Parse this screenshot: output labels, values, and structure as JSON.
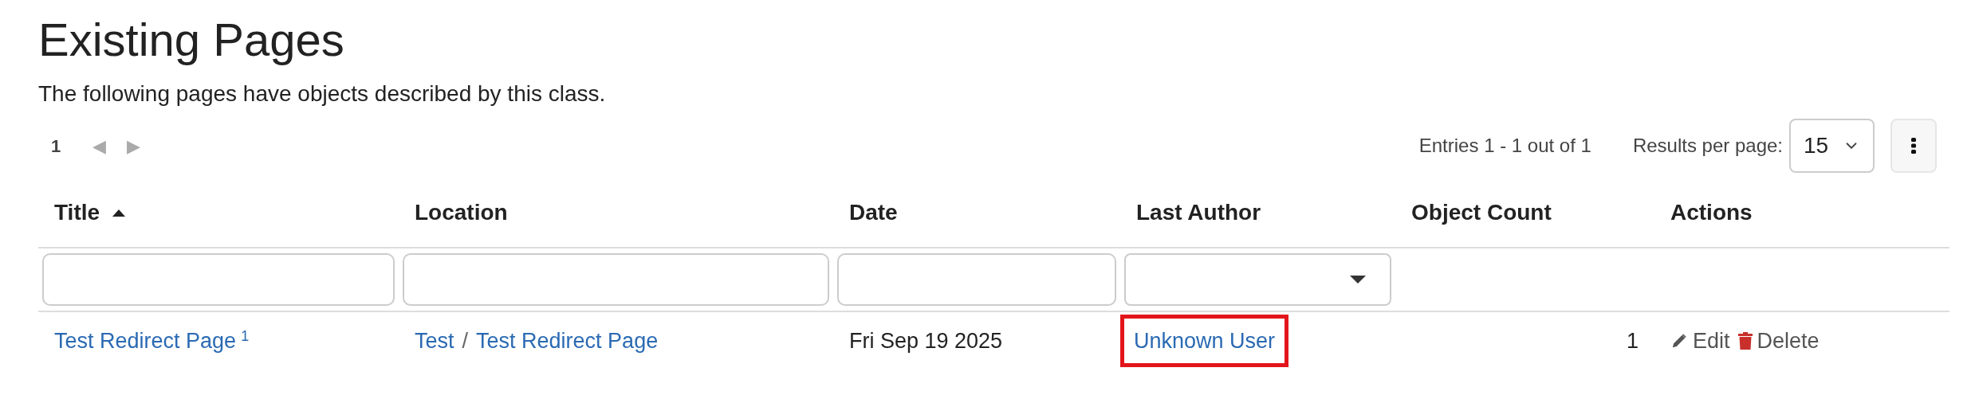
{
  "heading": "Existing Pages",
  "description": "The following pages have objects described by this class.",
  "pagination": {
    "current_page": "1",
    "previous": "◀",
    "next": "▶",
    "entries": "Entries 1 - 1 out of 1",
    "results_label": "Results per page:",
    "results_value": "15"
  },
  "table": {
    "columns": [
      {
        "label": "Title",
        "sorted": true
      },
      {
        "label": "Location",
        "sorted": false
      },
      {
        "label": "Date",
        "sorted": false
      },
      {
        "label": "Last Author",
        "sorted": false
      },
      {
        "label": "Object Count",
        "sorted": false
      },
      {
        "label": "Actions",
        "sorted": false
      }
    ],
    "filters": [
      {
        "kind": "text"
      },
      {
        "kind": "text"
      },
      {
        "kind": "text"
      },
      {
        "kind": "select"
      }
    ],
    "rows": [
      {
        "title": "Test Redirect Page",
        "title_note": "1",
        "location": [
          "Test",
          "Test Redirect Page"
        ],
        "location_separator": "/",
        "date": "Fri Sep 19 2025",
        "last_author": "Unknown User",
        "author_highlighted": true,
        "object_count": "1",
        "actions": [
          {
            "kind": "edit",
            "label": "Edit"
          },
          {
            "kind": "delete",
            "label": "Delete"
          }
        ]
      }
    ]
  }
}
